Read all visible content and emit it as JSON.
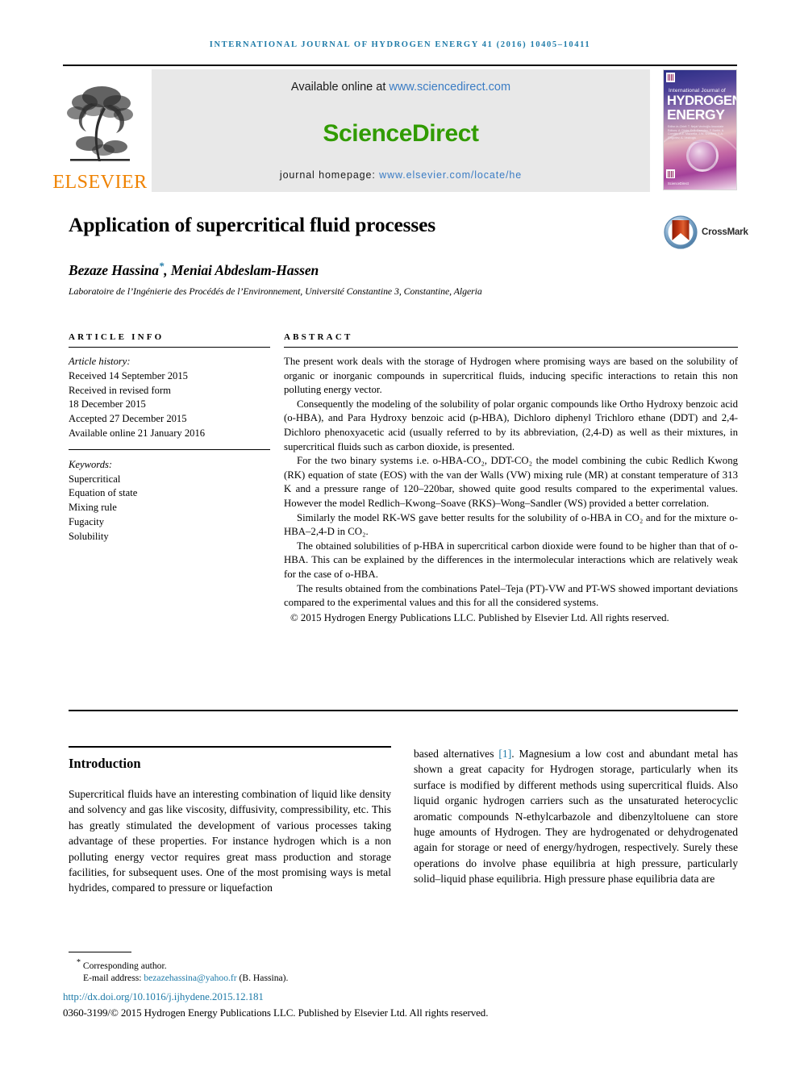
{
  "running_head": "International Journal of Hydrogen Energy 41 (2016) 10405–10411",
  "masthead": {
    "publisher_wordmark": "ELSEVIER",
    "available_prefix": "Available online at ",
    "available_link": "www.sciencedirect.com",
    "sciencedirect_logo": "ScienceDirect",
    "homepage_prefix": "journal homepage: ",
    "homepage_link": "www.elsevier.com/locate/he",
    "cover": {
      "line_small": "International Journal of",
      "line_hydrogen": "HYDROGEN",
      "line_energy": "ENERGY",
      "editors": "Editor-in-Chief: T. Nejat Veziroğlu\nAssociate Editors: A. Dicks, D.S. Damdeo, F. Barbir, A. Cornish, A.E. Mazzella, J.W. Sheffield, S.A. Grigoriev, A. Veziroglu",
      "footer_brand": "ScienceDirect"
    }
  },
  "article": {
    "title": "Application of supercritical fluid processes",
    "crossmark_label": "CrossMark",
    "authors": "Bezaze Hassina",
    "authors_rest": ", Meniai Abdeslam-Hassen",
    "corresponding_marker": "*",
    "affiliation": "Laboratoire de l’Ingénierie des Procédés de l’Environnement, Université Constantine 3, Constantine, Algeria"
  },
  "article_info": {
    "heading": "ARTICLE INFO",
    "history_label": "Article history:",
    "history": [
      "Received 14 September 2015",
      "Received in revised form",
      "18 December 2015",
      "Accepted 27 December 2015",
      "Available online 21 January 2016"
    ],
    "keywords_label": "Keywords:",
    "keywords": [
      "Supercritical",
      "Equation of state",
      "Mixing rule",
      "Fugacity",
      "Solubility"
    ]
  },
  "abstract": {
    "heading": "ABSTRACT",
    "paragraphs": [
      "The present work deals with the storage of Hydrogen where promising ways are based on the solubility of organic or inorganic compounds in supercritical fluids, inducing specific interactions to retain this non polluting energy vector.",
      "Consequently the modeling of the solubility of polar organic compounds like Ortho Hydroxy benzoic acid (o-HBA), and Para Hydroxy benzoic acid (p-HBA), Dichloro diphenyl Trichloro ethane (DDT) and 2,4-Dichloro phenoxyacetic acid (usually referred to by its abbreviation, (2,4-D) as well as their mixtures, in supercritical fluids such as carbon dioxide, is presented.",
      "For the two binary systems i.e. o-HBA-CO₂, DDT-CO₂ the model combining the cubic Redlich Kwong (RK) equation of state (EOS) with the van der Walls (VW) mixing rule (MR) at constant temperature of 313 K and a pressure range of 120–220bar, showed quite good results compared to the experimental values. However the model Redlich–Kwong–Soave (RKS)–Wong–Sandler (WS) provided a better correlation.",
      "Similarly the model RK-WS gave better results for the solubility of o-HBA in CO₂ and for the mixture o-HBA–2,4-D in CO₂.",
      "The obtained solubilities of p-HBA in supercritical carbon dioxide were found to be higher than that of o-HBA. This can be explained by the differences in the intermolecular interactions which are relatively weak for the case of o-HBA.",
      "The results obtained from the combinations Patel–Teja (PT)-VW and PT-WS showed important deviations compared to the experimental values and this for all the considered systems."
    ],
    "copyright": "© 2015 Hydrogen Energy Publications LLC. Published by Elsevier Ltd. All rights reserved."
  },
  "body": {
    "section_heading": "Introduction",
    "left_paragraph": "Supercritical fluids have an interesting combination of liquid like density and solvency and gas like viscosity, diffusivity, compressibility, etc. This has greatly stimulated the development of various processes taking advantage of these properties. For instance hydrogen which is a non polluting energy vector requires great mass production and storage facilities, for subsequent uses. One of the most promising ways is metal hydrides, compared to pressure or liquefaction",
    "right_paragraph_pre": "based alternatives ",
    "right_paragraph_ref": "[1]",
    "right_paragraph_post": ". Magnesium a low cost and abundant metal has shown a great capacity for Hydrogen storage, particularly when its surface is modified by different methods using supercritical fluids. Also liquid organic hydrogen carriers such as the unsaturated heterocyclic aromatic compounds N-ethylcarbazole and dibenzyltoluene can store huge amounts of Hydrogen. They are hydrogenated or dehydrogenated again for storage or need of energy/hydrogen, respectively. Surely these operations do involve phase equilibria at high pressure, particularly solid–liquid phase equilibria. High pressure phase equilibria data are"
  },
  "footer": {
    "corresponding_marker": "*",
    "corresponding_text": "Corresponding author.",
    "email_label": "E-mail address: ",
    "email_address": "bezazehassina@yahoo.fr",
    "email_suffix": " (B. Hassina).",
    "doi": "http://dx.doi.org/10.1016/j.ijhydene.2015.12.181",
    "issn_copyright": "0360-3199/© 2015 Hydrogen Energy Publications LLC. Published by Elsevier Ltd. All rights reserved."
  },
  "colors": {
    "accent_blue": "#1f7ba8",
    "link_blue": "#3a7cc4",
    "elsevier_orange": "#ef8200",
    "sciencedirect_green": "#319b00"
  }
}
